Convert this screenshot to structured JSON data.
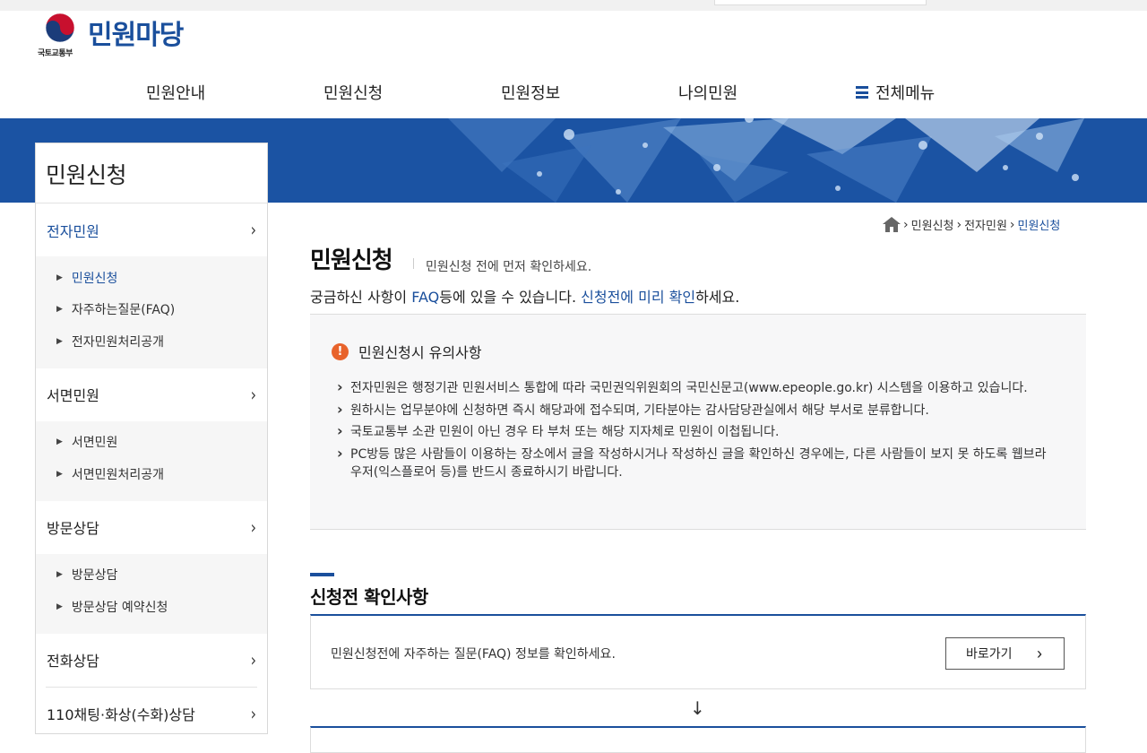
{
  "header": {
    "ministry": "국토교통부",
    "site_title": "민원마당"
  },
  "gnb": {
    "items": [
      "민원안내",
      "민원신청",
      "민원정보",
      "나의민원"
    ],
    "all_menu": "전체메뉴"
  },
  "lnb": {
    "title": "민원신청",
    "groups": [
      {
        "label": "전자민원",
        "items": [
          "민원신청",
          "자주하는질문(FAQ)",
          "전자민원처리공개"
        ]
      },
      {
        "label": "서면민원",
        "items": [
          "서면민원",
          "서면민원처리공개"
        ]
      },
      {
        "label": "방문상담",
        "items": [
          "방문상담",
          "방문상담 예약신청"
        ]
      },
      {
        "label": "전화상담",
        "items": []
      },
      {
        "label": "110채팅·화상(수화)상담",
        "items": []
      }
    ]
  },
  "breadcrumb": [
    "민원신청",
    "전자민원",
    "민원신청"
  ],
  "main": {
    "title": "민원신청",
    "subtitle": "민원신청 전에 먼저 확인하세요.",
    "faq_prefix": "궁금하신 사항이 ",
    "faq_link": "FAQ",
    "faq_middle": "등에 있을 수 있습니다. ",
    "faq_link2": "신청전에 미리 확인",
    "faq_suffix": "하세요.",
    "notice_title": "민원신청시 유의사항",
    "notice_items": [
      "전자민원은 행정기관 민원서비스 통합에 따라 국민권익위원회의 국민신문고(www.epeople.go.kr) 시스템을 이용하고 있습니다.",
      "원하시는 업무분야에 신청하면 즉시 해당과에 접수되며, 기타분야는 감사담당관실에서 해당 부서로 분류합니다.",
      "국토교통부 소관 민원이 아닌 경우 타 부처 또는 해당 지자체로 민원이 이첩됩니다.",
      "PC방등 많은 사람들이 이용하는 장소에서 글을 작성하시거나 작성하신 글을 확인하신 경우에는, 다른 사람들이 보지 못 하도록 웹브라우저(익스플로어 등)를 반드시 종료하시기 바랍니다."
    ],
    "section_title": "신청전 확인사항",
    "faq_box_text": "민원신청전에 자주하는 질문(FAQ) 정보를 확인하세요.",
    "go_button": "바로가기"
  },
  "colors": {
    "brand": "#1a4f9c",
    "banner": "#1b53a3",
    "warning": "#e8632b"
  },
  "icons": {
    "home": "home-icon",
    "warning": "exclamation-icon",
    "arrow": "arrow-down-icon"
  }
}
